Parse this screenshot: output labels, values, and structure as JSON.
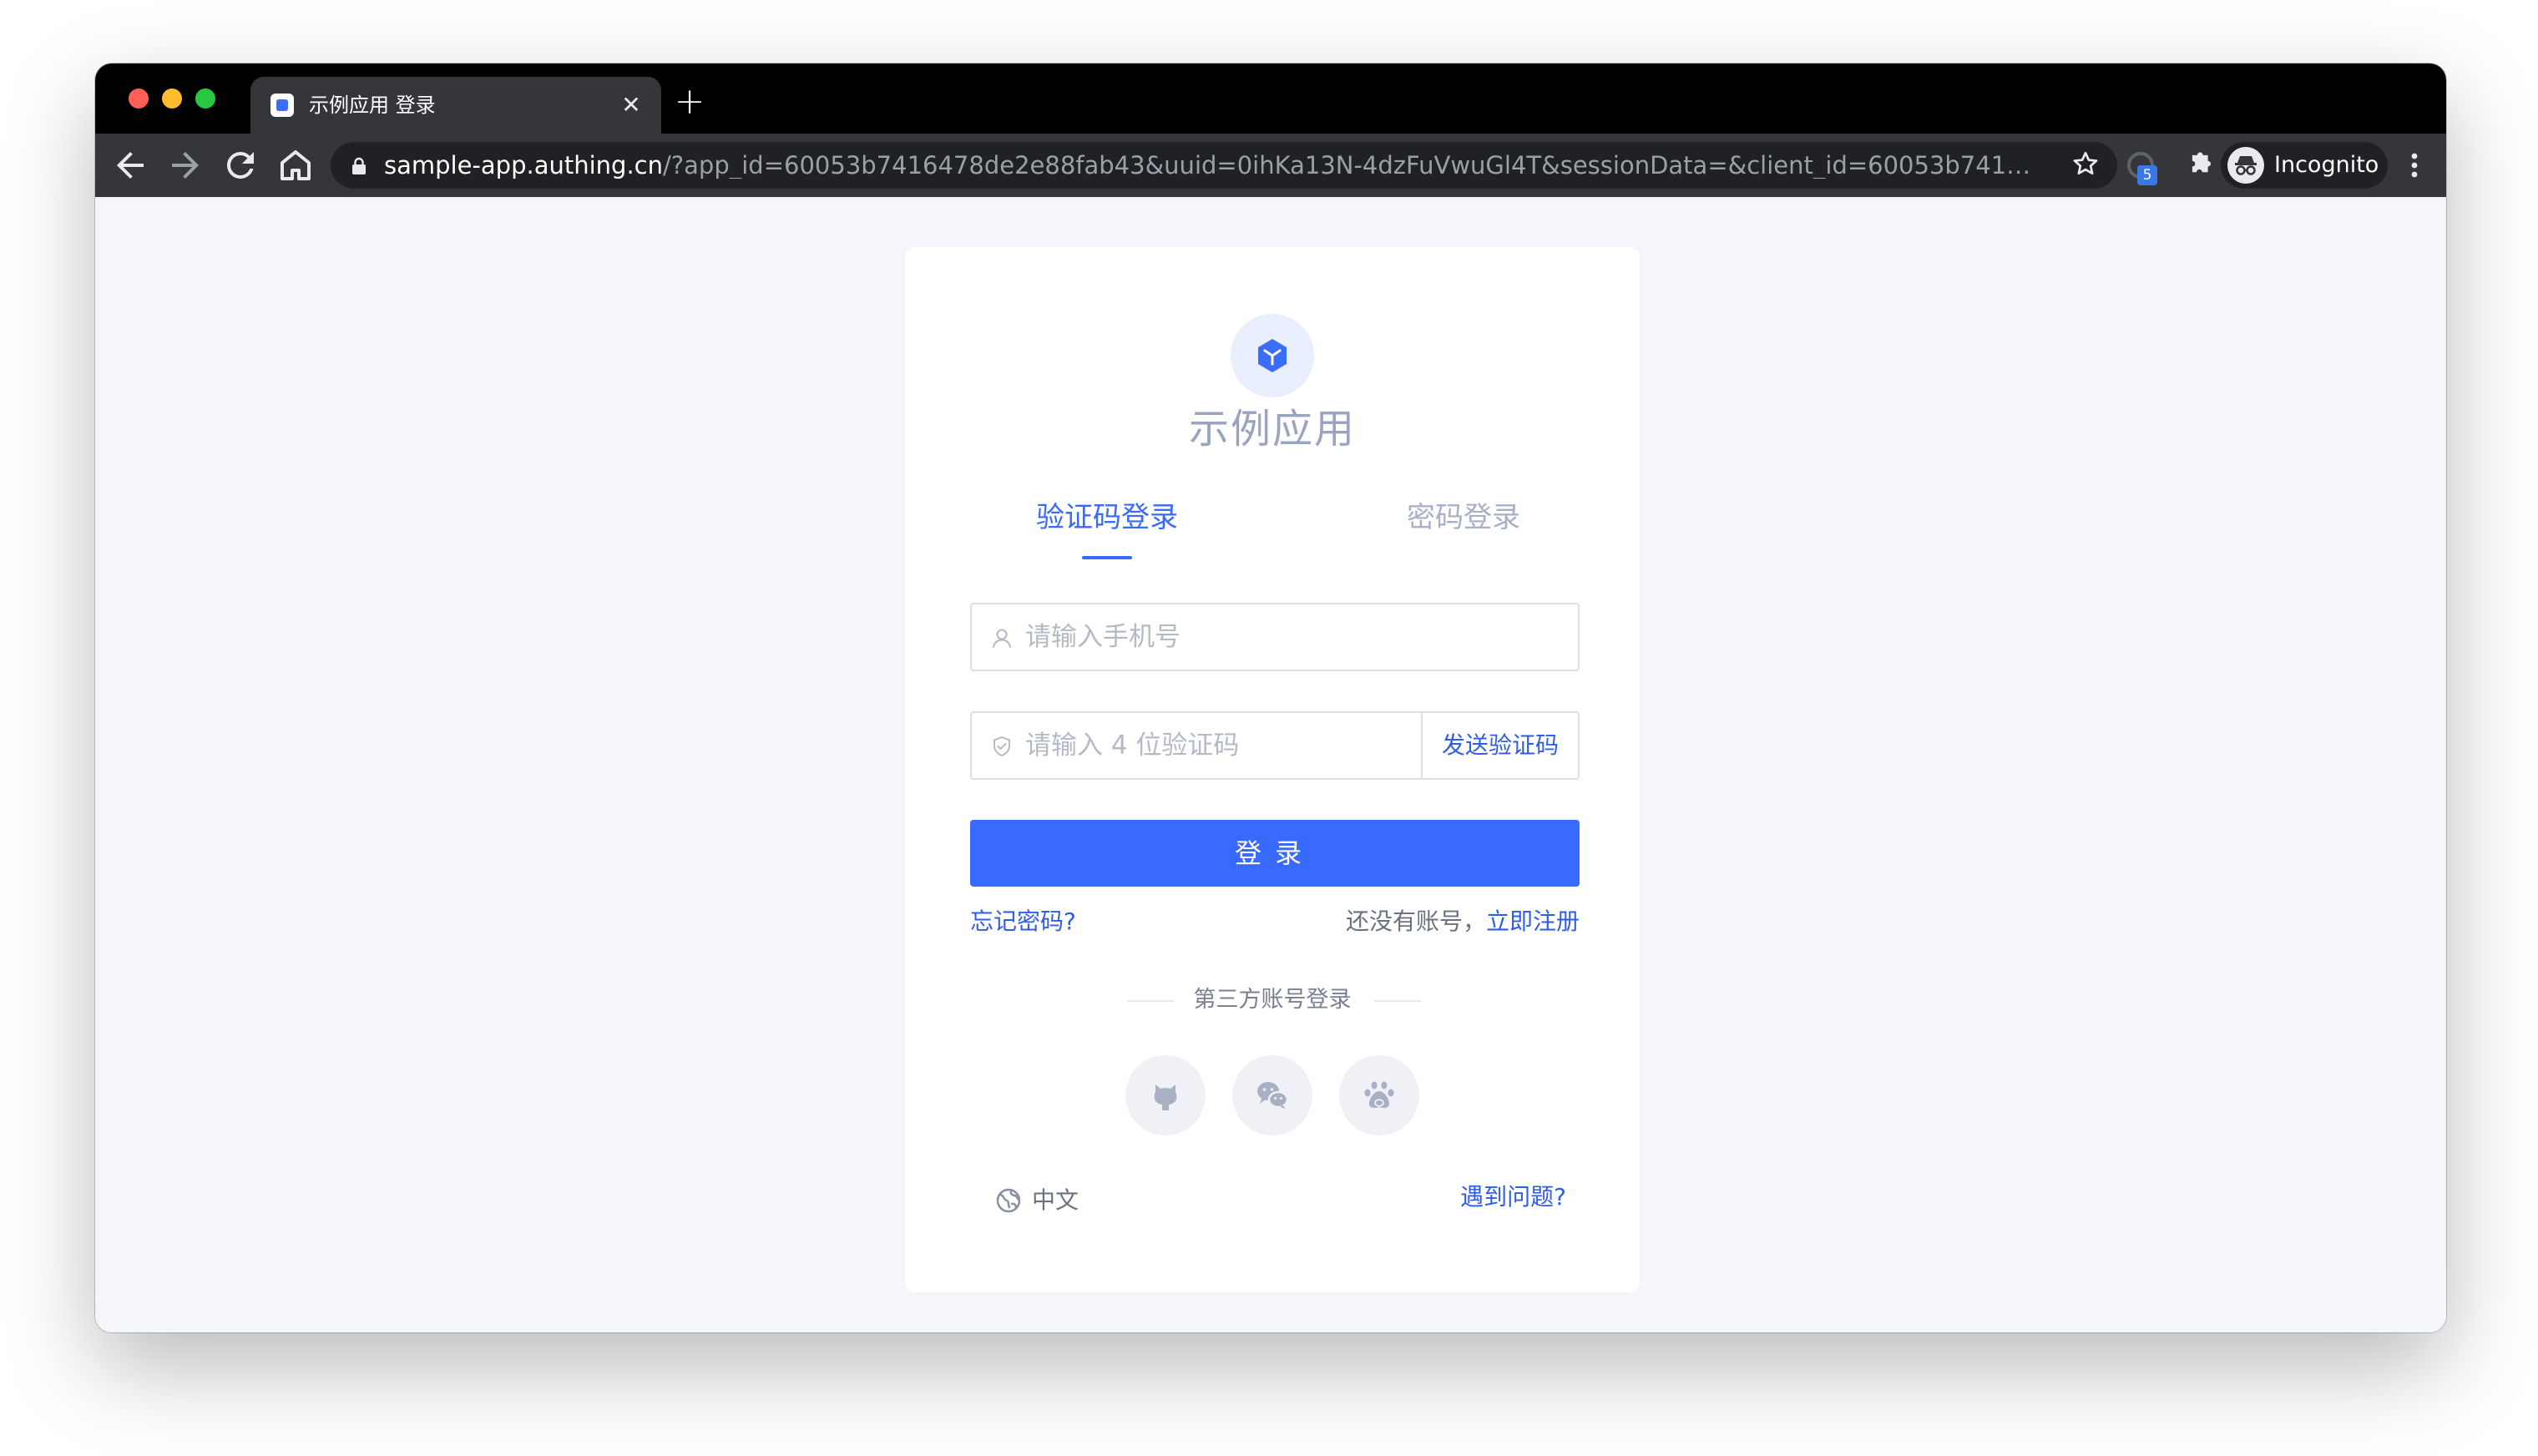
{
  "browser": {
    "tab_title": "示例应用 登录",
    "tab_close": "✕",
    "new_tab": "+",
    "url_host": "sample-app.authing.cn",
    "url_rest": "/?app_id=60053b7416478de2e88fab43&uuid=0ihKa13N-4dzFuVwuGl4T&sessionData=&client_id=60053b7416478de2e88...",
    "extension_badge": "5",
    "profile_label": "Incognito",
    "icons": [
      "back-arrow-icon",
      "forward-arrow-icon",
      "reload-icon",
      "home-icon",
      "lock-icon",
      "star-icon",
      "cast-icon",
      "puzzle-icon",
      "incognito-icon",
      "kebab-menu-icon"
    ]
  },
  "login": {
    "app_name": "示例应用",
    "tabs": [
      {
        "label": "验证码登录",
        "active": true
      },
      {
        "label": "密码登录",
        "active": false
      }
    ],
    "phone_placeholder": "请输入手机号",
    "code_placeholder": "请输入 4 位验证码",
    "send_code_label": "发送验证码",
    "submit_label": "登录",
    "forgot_password": "忘记密码?",
    "no_account_text": "还没有账号，",
    "register_label": "立即注册",
    "third_party_title": "第三方账号登录",
    "social_providers": [
      "github-icon",
      "wechat-icon",
      "baidu-icon"
    ],
    "language_label": "中文",
    "help_label": "遇到问题?"
  },
  "colors": {
    "primary": "#396aff",
    "link": "#2f5de8",
    "page_bg": "#f5f6fb",
    "chrome_bg": "#35363a"
  }
}
